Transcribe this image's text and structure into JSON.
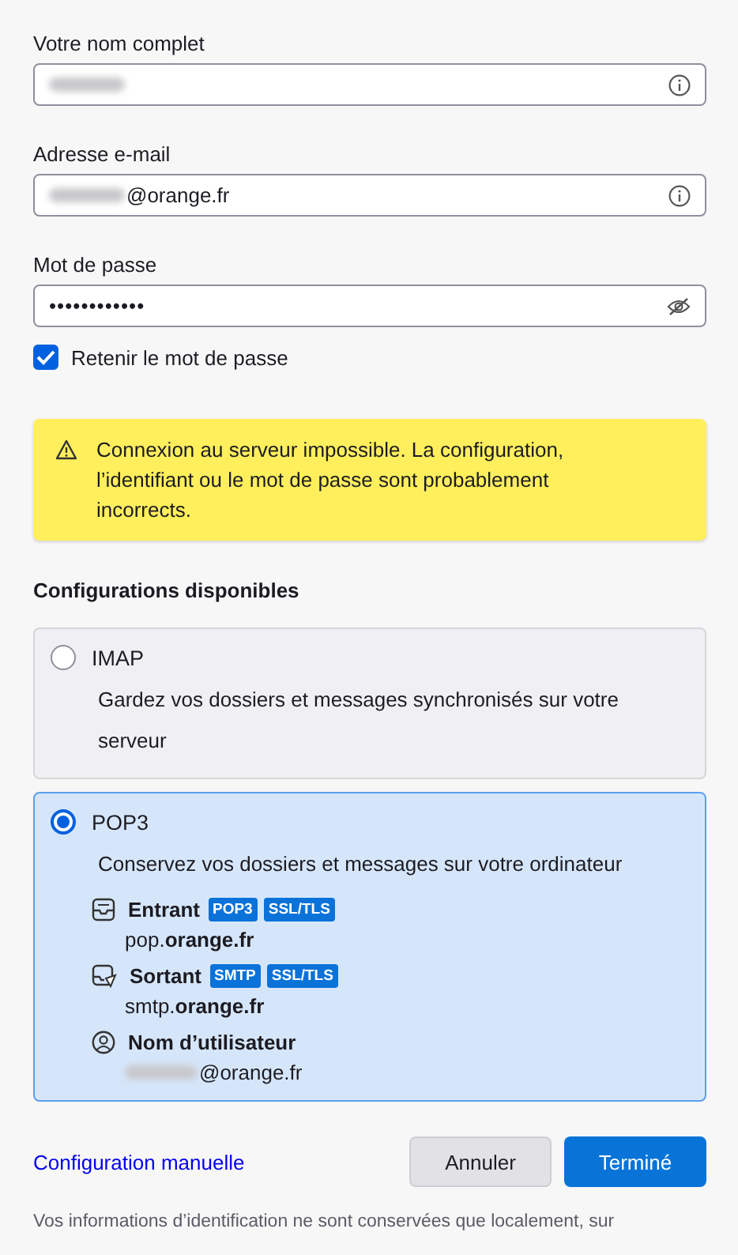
{
  "fields": [
    {
      "label": "Votre nom complet",
      "kind": "name",
      "redacted": true
    },
    {
      "label": "Adresse e-mail",
      "kind": "email",
      "redacted": true,
      "value": "@orange.fr"
    },
    {
      "label": "Mot de passe",
      "kind": "password",
      "redacted": false,
      "value": "••••••••••••"
    }
  ],
  "remember": {
    "label": "Retenir le mot de passe",
    "checked": true
  },
  "warning": "Connexion au serveur impossible. La configuration, l’identifiant ou le mot de passe sont probablement incorrects.",
  "configs_heading": "Configurations disponibles",
  "configs": [
    {
      "name": "IMAP",
      "selected": false,
      "description": "Gardez vos dossiers et messages synchronisés sur votre serveur"
    },
    {
      "name": "POP3",
      "selected": true,
      "description": "Conservez vos dossiers et messages sur votre ordinateur",
      "details": [
        {
          "kind": "incoming",
          "title": "Entrant",
          "tags": [
            "POP3",
            "SSL/TLS"
          ],
          "value": "pop.**orange.fr**",
          "redacted": false
        },
        {
          "kind": "outgoing",
          "title": "Sortant",
          "tags": [
            "SMTP",
            "SSL/TLS"
          ],
          "value": "smtp.**orange.fr**",
          "redacted": false
        },
        {
          "kind": "user",
          "title": "Nom d’utilisateur",
          "value": "@orange.fr",
          "redacted": true
        }
      ]
    }
  ],
  "manual_link": "Configuration manuelle",
  "buttons": [
    {
      "label": "Annuler",
      "kind": "secondary"
    },
    {
      "label": "Terminé",
      "kind": "primary"
    }
  ],
  "footer": "Vos informations d’identification ne sont conservées que localement, sur"
}
